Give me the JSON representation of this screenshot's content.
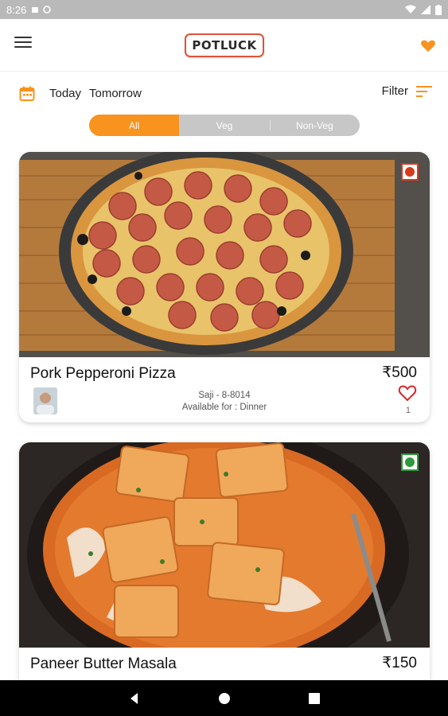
{
  "status_bar": {
    "time": "8:26"
  },
  "app": {
    "logo_text": "POTLUCK"
  },
  "date_filter": {
    "today": "Today",
    "tomorrow": "Tomorrow",
    "filter_label": "Filter"
  },
  "segments": [
    {
      "label": "All",
      "active": true
    },
    {
      "label": "Veg",
      "active": false
    },
    {
      "label": "Non-Veg",
      "active": false
    }
  ],
  "cards": [
    {
      "title": "Pork Pepperoni Pizza",
      "price": "₹500",
      "host": "Saji - 8-8014",
      "availability": "Available for : Dinner",
      "likes": "1",
      "diet": "non-veg",
      "image": "pepperoni-pizza"
    },
    {
      "title": "Paneer Butter Masala",
      "price": "₹150",
      "diet": "veg",
      "image": "paneer-butter-masala"
    }
  ],
  "colors": {
    "accent": "#f7931e",
    "non_veg": "#d63a1c",
    "veg": "#2e9a3a",
    "logo_border": "#e0523a"
  }
}
